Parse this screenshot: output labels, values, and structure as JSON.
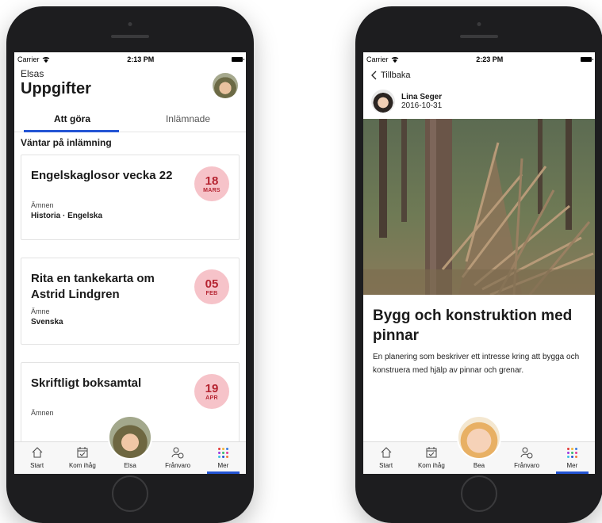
{
  "left": {
    "status": {
      "carrier": "Carrier",
      "time": "2:13 PM"
    },
    "header": {
      "small_name": "Elsas",
      "title": "Uppgifter"
    },
    "tabs": [
      {
        "label": "Att göra"
      },
      {
        "label": "Inlämnade"
      }
    ],
    "section_title": "Väntar på inlämning",
    "cards": [
      {
        "title": "Engelskaglosor vecka 22",
        "day": "18",
        "month": "MARS",
        "label": "Ämnen",
        "value": "Historia · Engelska"
      },
      {
        "title": "Rita en tankekarta om Astrid Lindgren",
        "day": "05",
        "month": "FEB",
        "label": "Ämne",
        "value": "Svenska"
      },
      {
        "title": "Skriftligt boksamtal",
        "day": "19",
        "month": "APR",
        "label": "Ämnen",
        "value": ""
      }
    ],
    "tabbar": {
      "start": "Start",
      "kom_ihag": "Kom ihåg",
      "center": "Elsa",
      "franvaro": "Frånvaro",
      "mer": "Mer"
    }
  },
  "right": {
    "status": {
      "carrier": "Carrier",
      "time": "2:23 PM"
    },
    "back_label": "Tillbaka",
    "author": {
      "name": "Lina Seger",
      "date": "2016-10-31"
    },
    "post": {
      "title": "Bygg och konstruktion med pinnar",
      "body": "En planering som beskriver ett intresse kring att bygga och konstruera med hjälp av pinnar och grenar."
    },
    "tabbar": {
      "start": "Start",
      "kom_ihag": "Kom ihåg",
      "center": "Bea",
      "franvaro": "Frånvaro",
      "mer": "Mer"
    }
  },
  "colors": {
    "accent": "#2354d4",
    "badge_bg": "#f6c3c9",
    "badge_text": "#b52330"
  },
  "icons": [
    "wifi-icon",
    "battery-icon",
    "home-icon",
    "calendar-check-icon",
    "person-clock-icon",
    "more-dots-icon",
    "chevron-left-icon"
  ]
}
